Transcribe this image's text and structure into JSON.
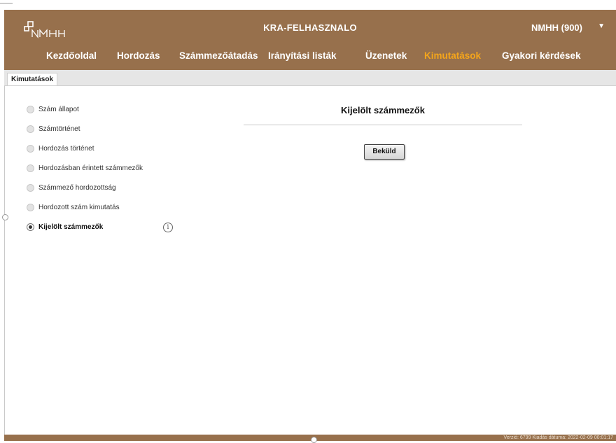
{
  "header": {
    "logo_text": "NM-H",
    "app_title": "KRA-FELHASZNALO",
    "user": "NMHH (900)",
    "user_menu_icon": "caret-down-icon"
  },
  "nav": {
    "items": [
      {
        "label": "Kezdőoldal"
      },
      {
        "label": "Hordozás"
      },
      {
        "label": "Számmezőátadás"
      },
      {
        "label": "Irányítási listák"
      },
      {
        "label": "Üzenetek"
      },
      {
        "label": "Kimutatások",
        "active": true
      },
      {
        "label": "Gyakori kérdések"
      }
    ],
    "active_color": "#f4a51b"
  },
  "breadcrumb": {
    "tab_label": "Kimutatások"
  },
  "sidebar": {
    "options": [
      {
        "label": "Szám állapot",
        "selected": false
      },
      {
        "label": "Számtörténet",
        "selected": false
      },
      {
        "label": "Hordozás történet",
        "selected": false
      },
      {
        "label": "Hordozásban érintett számmezők",
        "selected": false
      },
      {
        "label": "Számmező hordozottság",
        "selected": false
      },
      {
        "label": "Hordozott szám kimutatás",
        "selected": false
      },
      {
        "label": "Kijelölt számmezők",
        "selected": true
      }
    ],
    "info_icon": "info-icon"
  },
  "main": {
    "title": "Kijelölt számmezők",
    "submit_label": "Beküld"
  },
  "footer": {
    "version_text": "Verzió: 6799 Kiadás dátuma: 2022-02-09 00:01:17"
  },
  "colors": {
    "header_bg": "#97704c",
    "tabbar_bg": "#e6e6e6"
  }
}
